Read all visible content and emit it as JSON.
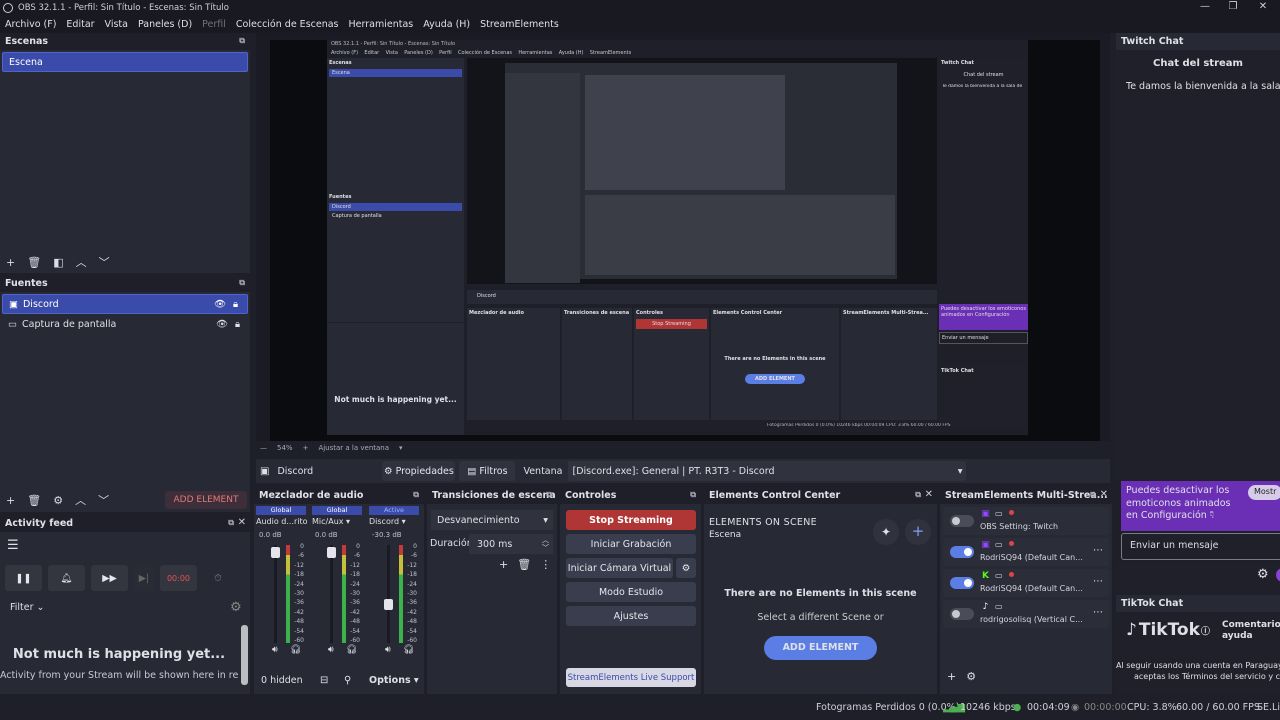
{
  "window": {
    "title": "OBS 32.1.1 - Perfil: Sin Título - Escenas: Sin Título",
    "min": "—",
    "max": "❐",
    "close": "✕"
  },
  "menu": [
    "Archivo (F)",
    "Editar",
    "Vista",
    "Paneles (D)",
    "Perfil",
    "Colección de Escenas",
    "Herramientas",
    "Ayuda (H)",
    "StreamElements"
  ],
  "scenes": {
    "title": "Escenas",
    "items": [
      "Escena"
    ]
  },
  "sources": {
    "title": "Fuentes",
    "items": [
      "Discord",
      "Captura de pantalla"
    ],
    "add_element": "ADD ELEMENT"
  },
  "activity": {
    "title": "Activity feed",
    "filter": "Filter",
    "empty_title": "Not much is happening yet...",
    "empty_sub": "Activity from your Stream will be shown here in real-",
    "rec": "00:00"
  },
  "inner": {
    "title": "OBS 32.1.1 - Perfil: Sin Título - Escenas: Sin Título",
    "menu": "Archivo (F)    Editar    Vista    Paneles (D)    Perfil    Colección de Escenas    Herramientas    Ayuda (H)    StreamElements",
    "escenas": "Escenas",
    "escena": "Escena",
    "fuentes": "Fuentes",
    "discord": "Discord",
    "captura": "Captura de pantalla",
    "twitch": "Twitch Chat",
    "chat": "Chat del stream",
    "welcome": "Te damos la bienvenida a la sala de",
    "mensaje": "Enviar un mensaje",
    "emotes": "Puedes desactivar los emoticonos animados en Configuración",
    "tiktok": "TikTok Chat",
    "mixer": "Mezclador de audio",
    "transitions": "Transiciones de escena",
    "controls": "Controles",
    "ecc": "Elements Control Center",
    "sems": "StreamElements Multi-Strea...",
    "stop": "Stop Streaming",
    "nothing": "There are no Elements in this scene",
    "add": "ADD ELEMENT",
    "status": "Fotogramas Perdidos 0 (0.0%)   10246 kbps   00:04:09   CPU: 3.8%   60.00 / 60.00 FPS"
  },
  "preview_bar": {
    "minus": "—",
    "zoom": "54%",
    "plus": "+",
    "fit": "Ajustar a la ventana"
  },
  "sourcebar": {
    "name": "Discord",
    "props": "Propiedades",
    "filters": "Filtros",
    "window_label": "Ventana",
    "window_value": "[Discord.exe]: General | PT. R3T3 - Discord"
  },
  "mixer": {
    "title": "Mezclador de audio",
    "channels": [
      {
        "name": "Audio d...ritorio",
        "tag": "Global",
        "db": "0.0 dB"
      },
      {
        "name": "Mic/Aux",
        "tag": "Global",
        "db": "0.0 dB"
      },
      {
        "name": "Discord",
        "tag": "Active",
        "db": "-30.3 dB"
      }
    ],
    "scale": [
      "0",
      "-6",
      "-12",
      "-18",
      "-24",
      "-30",
      "-36",
      "-42",
      "-48",
      "-54",
      "-60"
    ],
    "hidden": "0 hidden",
    "options": "Options"
  },
  "transitions": {
    "title": "Transiciones de escena",
    "selected": "Desvanecimiento",
    "duration_label": "Duración",
    "duration": "300 ms"
  },
  "controls": {
    "title": "Controles",
    "stop": "Stop Streaming",
    "record": "Iniciar Grabación",
    "vcam": "Iniciar Cámara Virtual",
    "studio": "Modo Estudio",
    "settings": "Ajustes",
    "support": "StreamElements Live Support"
  },
  "ecc": {
    "title": "Elements Control Center",
    "heading": "ELEMENTS ON SCENE",
    "scene": "Escena",
    "empty": "There are no Elements in this scene",
    "hint": "Select a different Scene or",
    "add": "ADD ELEMENT"
  },
  "sems": {
    "title": "StreamElements Multi-Strea...",
    "items": [
      {
        "name": "OBS Setting: Twitch",
        "on": false,
        "platform": "twitch"
      },
      {
        "name": "RodriSQ94 (Default Can...",
        "on": true,
        "platform": "twitch"
      },
      {
        "name": "RodriSQ94 (Default Can...",
        "on": true,
        "platform": "kick"
      },
      {
        "name": "rodrigosolisq (Vertical C...",
        "on": false,
        "platform": "tiktok"
      }
    ]
  },
  "twitch": {
    "title": "Twitch Chat",
    "header": "Chat del stream",
    "welcome": "Te damos la bienvenida a la sala de",
    "banner": "Puedes desactivar los emoticonos animados en Configuración",
    "banner_btn": "Mostr",
    "input": "Enviar un mensaje"
  },
  "tiktok": {
    "title": "TikTok Chat",
    "logo": "TikTok",
    "side": "Comentarios ayuda",
    "terms1": "Al seguir usando una cuenta en Paraguay",
    "terms2": "aceptas los Términos del servicio y c"
  },
  "status": {
    "dropped": "Fotogramas Perdidos 0 (0.0%)",
    "kbps": "10246 kbps",
    "stream_time": "00:04:09",
    "rec_time": "00:00:00",
    "cpu": "CPU: 3.8%",
    "fps": "60.00 / 60.00 FPS",
    "se": "SE.Liv"
  },
  "colors": {
    "accent": "#3b4baa",
    "stop": "#b03535",
    "purple": "#6b2fb6",
    "addbtn": "#5b7ee5"
  }
}
